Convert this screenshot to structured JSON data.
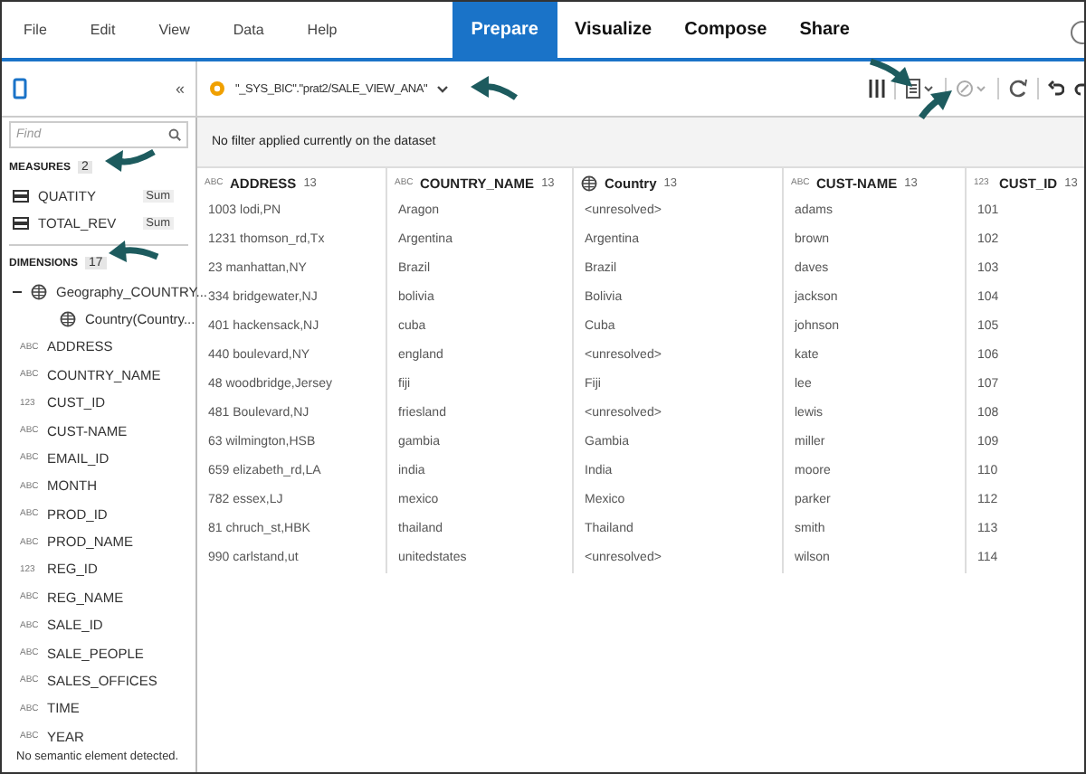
{
  "menu": [
    {
      "label": "File",
      "kind": "menu",
      "selected": false
    },
    {
      "label": "Edit",
      "kind": "menu",
      "selected": false
    },
    {
      "label": "View",
      "kind": "menu",
      "selected": false
    },
    {
      "label": "Data",
      "kind": "menu",
      "selected": false
    },
    {
      "label": "Help",
      "kind": "menu",
      "selected": false
    },
    {
      "label": "Prepare",
      "kind": "mode",
      "selected": true
    },
    {
      "label": "Visualize",
      "kind": "mode",
      "selected": false
    },
    {
      "label": "Compose",
      "kind": "mode",
      "selected": false
    },
    {
      "label": "Share",
      "kind": "mode",
      "selected": false
    }
  ],
  "toolbar": {
    "collapse": "«",
    "dataset": "\"_SYS_BIC\".\"prat2/SALE_VIEW_ANA\""
  },
  "sidebar": {
    "search": {
      "placeholder": "Find"
    },
    "measures": {
      "title": "MEASURES",
      "count": "2",
      "items": [
        {
          "name": "QUATITY",
          "aggregation": "Sum"
        },
        {
          "name": "TOTAL_REV",
          "aggregation": "Sum"
        }
      ]
    },
    "dimensions": {
      "title": "DIMENSIONS",
      "count": "17",
      "items": [
        {
          "kind": "geo",
          "name": "Geography_COUNTRY...",
          "expanded": true,
          "children": [
            {
              "kind": "geo",
              "name": "Country(Country..."
            }
          ]
        },
        {
          "kind": "text",
          "glyph": "ABC",
          "name": "ADDRESS"
        },
        {
          "kind": "text",
          "glyph": "ABC",
          "name": "COUNTRY_NAME"
        },
        {
          "kind": "text",
          "glyph": "123",
          "name": "CUST_ID"
        },
        {
          "kind": "text",
          "glyph": "ABC",
          "name": "CUST-NAME"
        },
        {
          "kind": "text",
          "glyph": "ABC",
          "name": "EMAIL_ID"
        },
        {
          "kind": "text",
          "glyph": "ABC",
          "name": "MONTH"
        },
        {
          "kind": "text",
          "glyph": "ABC",
          "name": "PROD_ID"
        },
        {
          "kind": "text",
          "glyph": "ABC",
          "name": "PROD_NAME"
        },
        {
          "kind": "text",
          "glyph": "123",
          "name": "REG_ID"
        },
        {
          "kind": "text",
          "glyph": "ABC",
          "name": "REG_NAME"
        },
        {
          "kind": "text",
          "glyph": "ABC",
          "name": "SALE_ID"
        },
        {
          "kind": "text",
          "glyph": "ABC",
          "name": "SALE_PEOPLE"
        },
        {
          "kind": "text",
          "glyph": "ABC",
          "name": "SALES_OFFICES"
        },
        {
          "kind": "text",
          "glyph": "ABC",
          "name": "TIME"
        },
        {
          "kind": "text",
          "glyph": "ABC",
          "name": "YEAR"
        }
      ]
    },
    "footer": "No semantic element detected."
  },
  "filter_message": "No filter applied currently on the dataset",
  "table": {
    "columns": [
      {
        "kind": "text",
        "glyph": "ABC",
        "name": "ADDRESS",
        "count": "13"
      },
      {
        "kind": "text",
        "glyph": "ABC",
        "name": "COUNTRY_NAME",
        "count": "13"
      },
      {
        "kind": "geo",
        "name": "Country",
        "count": "13"
      },
      {
        "kind": "text",
        "glyph": "ABC",
        "name": "CUST-NAME",
        "count": "13"
      },
      {
        "kind": "text",
        "glyph": "123",
        "name": "CUST_ID",
        "count": "13"
      }
    ],
    "rows": [
      [
        "1003 lodi,PN",
        "Aragon",
        "<unresolved>",
        "adams",
        "101"
      ],
      [
        "1231 thomson_rd,Tx",
        "Argentina",
        "Argentina",
        "brown",
        "102"
      ],
      [
        "23 manhattan,NY",
        "Brazil",
        "Brazil",
        "daves",
        "103"
      ],
      [
        "334 bridgewater,NJ",
        "bolivia",
        "Bolivia",
        "jackson",
        "104"
      ],
      [
        "401 hackensack,NJ",
        "cuba",
        "Cuba",
        "johnson",
        "105"
      ],
      [
        "440 boulevard,NY",
        "england",
        "<unresolved>",
        "kate",
        "106"
      ],
      [
        "48 woodbridge,Jersey",
        "fiji",
        "Fiji",
        "lee",
        "107"
      ],
      [
        "481 Boulevard,NJ",
        "friesland",
        "<unresolved>",
        "lewis",
        "108"
      ],
      [
        "63 wilmington,HSB",
        "gambia",
        "Gambia",
        "miller",
        "109"
      ],
      [
        "659 elizabeth_rd,LA",
        "india",
        "India",
        "moore",
        "110"
      ],
      [
        "782 essex,LJ",
        "mexico",
        "Mexico",
        "parker",
        "112"
      ],
      [
        "81 chruch_st,HBK",
        "thailand",
        "Thailand",
        "smith",
        "113"
      ],
      [
        "990 carlstand,ut",
        "unitedstates",
        "<unresolved>",
        "wilson",
        "114"
      ]
    ]
  }
}
